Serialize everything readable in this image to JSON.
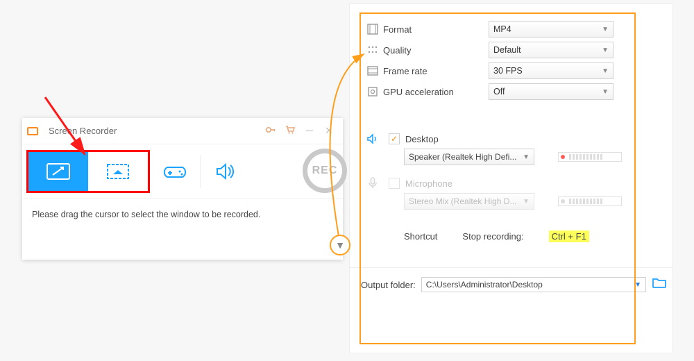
{
  "recorder": {
    "title": "Screen Recorder",
    "rec_label": "REC",
    "instruction": "Please drag the cursor to select the window to be recorded."
  },
  "settings": {
    "rows": {
      "format": {
        "label": "Format",
        "value": "MP4"
      },
      "quality": {
        "label": "Quality",
        "value": "Default"
      },
      "fps": {
        "label": "Frame rate",
        "value": "30 FPS"
      },
      "gpu": {
        "label": "GPU acceleration",
        "value": "Off"
      }
    },
    "audio": {
      "desktop": {
        "label": "Desktop",
        "device": "Speaker (Realtek High Defi...",
        "checked": true
      },
      "mic": {
        "label": "Microphone",
        "device": "Stereo Mix (Realtek High D...",
        "checked": false
      }
    },
    "shortcut": {
      "label": "Shortcut",
      "action": "Stop recording:",
      "keys": "Ctrl + F1"
    },
    "output": {
      "label": "Output folder:",
      "path": "C:\\Users\\Administrator\\Desktop"
    }
  }
}
